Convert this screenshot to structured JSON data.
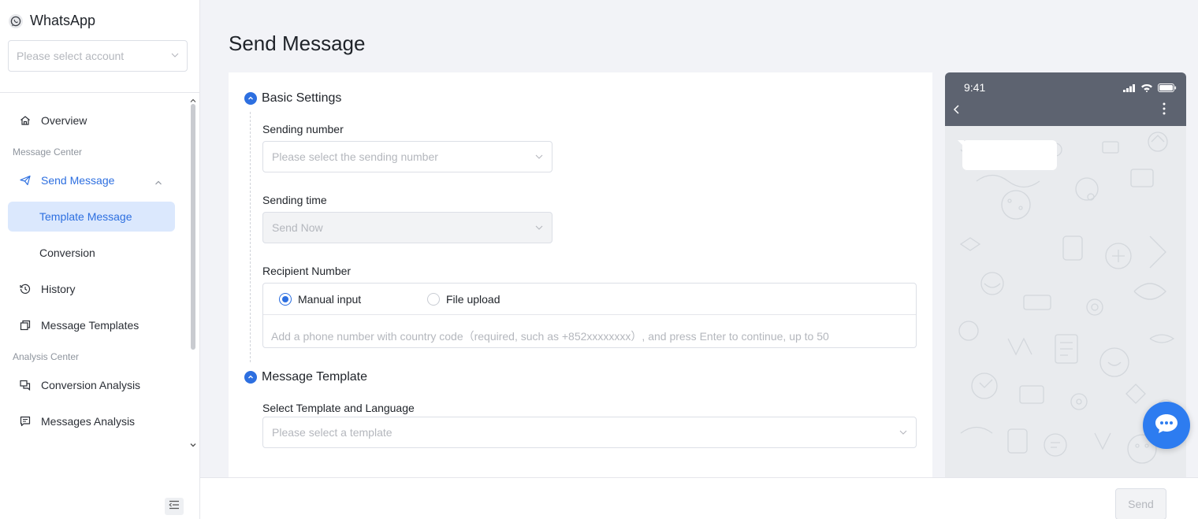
{
  "app": {
    "title": "WhatsApp",
    "icon": "whatsapp-icon"
  },
  "account": {
    "placeholder": "Please select account"
  },
  "sidebar": {
    "items": [
      {
        "label": "Overview",
        "icon": "home-icon"
      },
      {
        "label": "Send Message",
        "icon": "send-icon",
        "expanded": true
      },
      {
        "label": "Template Message",
        "selected": true
      },
      {
        "label": "Conversion"
      },
      {
        "label": "History",
        "icon": "history-icon"
      },
      {
        "label": "Message Templates",
        "icon": "copy-icon"
      },
      {
        "label": "Conversion Analysis",
        "icon": "chat-analysis-icon"
      },
      {
        "label": "Messages Analysis",
        "icon": "message-analysis-icon"
      }
    ],
    "groups": {
      "message_center": "Message Center",
      "analysis_center": "Analysis Center"
    }
  },
  "main": {
    "title": "Send Message",
    "basic_settings": {
      "title": "Basic Settings",
      "sending_number": {
        "label": "Sending number",
        "placeholder": "Please select the sending number"
      },
      "sending_time": {
        "label": "Sending time",
        "value": "Send Now",
        "disabled": true
      },
      "recipient": {
        "label": "Recipient Number",
        "options": [
          {
            "label": "Manual input",
            "checked": true
          },
          {
            "label": "File upload",
            "checked": false
          }
        ],
        "input_placeholder": "Add a phone number with country code（required, such as +852xxxxxxxx）, and press Enter to continue, up to 50"
      }
    },
    "message_template": {
      "title": "Message Template",
      "select": {
        "label": "Select Template and Language",
        "placeholder": "Please select a template"
      }
    }
  },
  "preview": {
    "time": "9:41"
  },
  "footer": {
    "send_label": "Send"
  },
  "colors": {
    "accent": "#2d6fe0",
    "selected_bg": "#dbe8fd",
    "phone_header": "#5d6370",
    "fab": "#2d7cf0"
  }
}
